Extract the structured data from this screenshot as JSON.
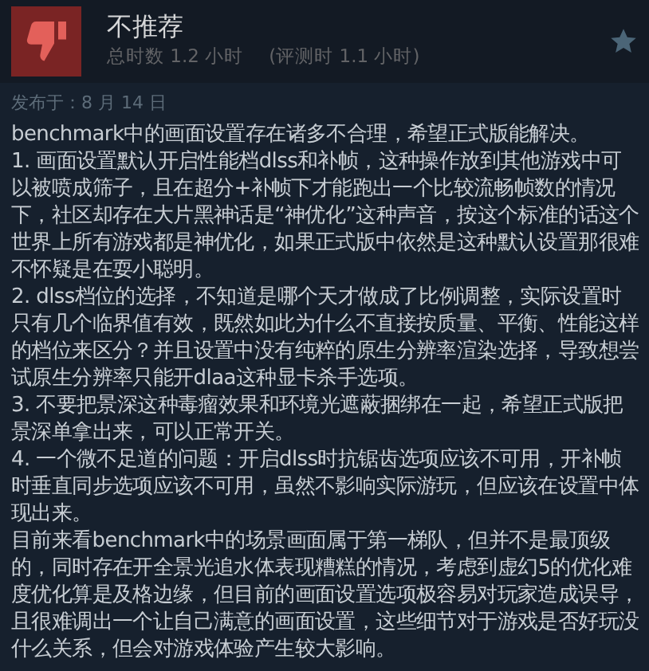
{
  "header": {
    "verdict": "不推荐",
    "recommended": false,
    "playtime": "总时数 1.2 小时",
    "playtime_at_review": "(评测时 1.1 小时)"
  },
  "posted": "发布于：8 月 14 日",
  "paragraphs": [
    "benchmark中的画面设置存在诸多不合理，希望正式版能解决。",
    "1. 画面设置默认开启性能档dlss和补帧，这种操作放到其他游戏中可以被喷成筛子，且在超分+补帧下才能跑出一个比较流畅帧数的情况下，社区却存在大片黑神话是“神优化”这种声音，按这个标准的话这个世界上所有游戏都是神优化，如果正式版中依然是这种默认设置那很难不怀疑是在耍小聪明。",
    "2. dlss档位的选择，不知道是哪个天才做成了比例调整，实际设置时只有几个临界值有效，既然如此为什么不直接按质量、平衡、性能这样的档位来区分？并且设置中没有纯粹的原生分辨率渲染选择，导致想尝试原生分辨率只能开dlaa这种显卡杀手选项。",
    "3. 不要把景深这种毒瘤效果和环境光遮蔽捆绑在一起，希望正式版把景深单拿出来，可以正常开关。",
    "4. 一个微不足道的问题：开启dlss时抗锯齿选项应该不可用，开补帧时垂直同步选项应该不可用，虽然不影响实际游玩，但应该在设置中体现出来。",
    "目前来看benchmark中的场景画面属于第一梯队，但并不是最顶级的，同时存在开全景光追水体表现糟糕的情况，考虑到虚幻5的优化难度优化算是及格边缘，但目前的画面设置选项极容易对玩家造成误导，且很难调出一个让自己满意的画面设置，这些细节对于游戏是否好玩没什么关系，但会对游戏体验产生较大影响。"
  ]
}
